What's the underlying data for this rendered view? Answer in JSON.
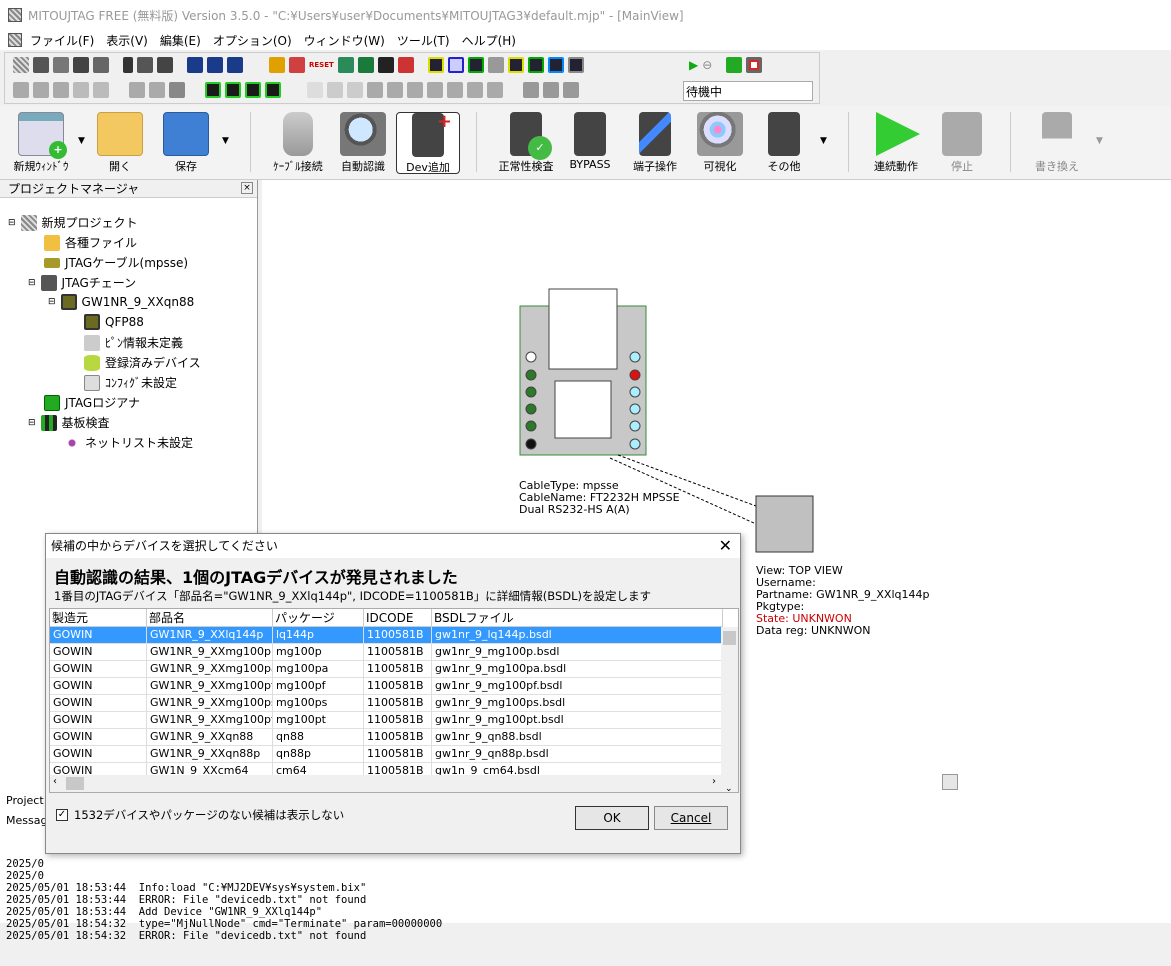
{
  "window": {
    "title": "MITOUJTAG FREE (無料版) Version 3.5.0 - \"C:¥Users¥user¥Documents¥MITOUJTAG3¥default.mjp\" - [MainView]"
  },
  "menu": [
    "ファイル(F)",
    "表示(V)",
    "編集(E)",
    "オプション(O)",
    "ウィンドウ(W)",
    "ツール(T)",
    "ヘルプ(H)"
  ],
  "toolbar": {
    "status_value": "待機中",
    "reset_label": "RESET"
  },
  "ribbon": [
    {
      "label": "新規ｳｨﾝﾄﾞｳ",
      "icon": "new-window-icon"
    },
    {
      "label": "開く",
      "icon": "open-folder-icon"
    },
    {
      "label": "保存",
      "icon": "save-icon"
    },
    {
      "label": "ｹｰﾌﾞﾙ接続",
      "icon": "cable-icon"
    },
    {
      "label": "自動認識",
      "icon": "auto-detect-icon"
    },
    {
      "label": "Dev追加",
      "icon": "add-device-icon"
    },
    {
      "label": "正常性検査",
      "icon": "check-icon"
    },
    {
      "label": "BYPASS",
      "icon": "bypass-icon"
    },
    {
      "label": "端子操作",
      "icon": "pin-operation-icon"
    },
    {
      "label": "可視化",
      "icon": "visualize-icon"
    },
    {
      "label": "その他",
      "icon": "other-icon"
    },
    {
      "label": "連続動作",
      "icon": "play-icon"
    },
    {
      "label": "停止",
      "icon": "stop-icon"
    },
    {
      "label": "書き換え",
      "icon": "write-icon"
    }
  ],
  "project": {
    "header": "プロジェクトマネージャ",
    "tree": [
      {
        "label": "新規プロジェクト",
        "level": 0
      },
      {
        "label": "各種ファイル",
        "level": 1
      },
      {
        "label": "JTAGケーブル(mpsse)",
        "level": 1
      },
      {
        "label": "JTAGチェーン",
        "level": 1
      },
      {
        "label": "GW1NR_9_XXqn88",
        "level": 2
      },
      {
        "label": "QFP88",
        "level": 3
      },
      {
        "label": "ﾋﾟﾝ情報未定義",
        "level": 3
      },
      {
        "label": "登録済みデバイス",
        "level": 3
      },
      {
        "label": "ｺﾝﾌｨｸﾞ未設定",
        "level": 3
      },
      {
        "label": "JTAGロジアナ",
        "level": 1
      },
      {
        "label": "基板検査",
        "level": 1
      },
      {
        "label": "ネットリスト未設定",
        "level": 2
      }
    ],
    "tab": "Project"
  },
  "cable": {
    "lines": [
      "CableType: mpsse",
      "CableName: FT2232H MPSSE",
      "Dual RS232-HS A(A)"
    ]
  },
  "device": {
    "lines": [
      "View: TOP VIEW",
      "Username:",
      "Partname: GW1NR_9_XXlq144p",
      "Pkgtype:",
      "State: UNKNWON",
      "Data reg: UNKNWON"
    ],
    "state_color": "#cc0000"
  },
  "dialog": {
    "title": "候補の中からデバイスを選択してください",
    "heading": "自動認識の結果、1個のJTAGデバイスが発見されました",
    "subtext": "1番目のJTAGデバイス「部品名=\"GW1NR_9_XXlq144p\", IDCODE=1100581B」に詳細情報(BSDL)を設定します",
    "columns": [
      "製造元",
      "部品名",
      "パッケージ",
      "IDCODE",
      "BSDLファイル"
    ],
    "rows": [
      [
        "GOWIN",
        "GW1NR_9_XXlq144p",
        "lq144p",
        "1100581B",
        "gw1nr_9_lq144p.bsdl"
      ],
      [
        "GOWIN",
        "GW1NR_9_XXmg100p",
        "mg100p",
        "1100581B",
        "gw1nr_9_mg100p.bsdl"
      ],
      [
        "GOWIN",
        "GW1NR_9_XXmg100pa",
        "mg100pa",
        "1100581B",
        "gw1nr_9_mg100pa.bsdl"
      ],
      [
        "GOWIN",
        "GW1NR_9_XXmg100pf",
        "mg100pf",
        "1100581B",
        "gw1nr_9_mg100pf.bsdl"
      ],
      [
        "GOWIN",
        "GW1NR_9_XXmg100ps",
        "mg100ps",
        "1100581B",
        "gw1nr_9_mg100ps.bsdl"
      ],
      [
        "GOWIN",
        "GW1NR_9_XXmg100pt",
        "mg100pt",
        "1100581B",
        "gw1nr_9_mg100pt.bsdl"
      ],
      [
        "GOWIN",
        "GW1NR_9_XXqn88",
        "qn88",
        "1100581B",
        "gw1nr_9_qn88.bsdl"
      ],
      [
        "GOWIN",
        "GW1NR_9_XXqn88p",
        "qn88p",
        "1100581B",
        "gw1nr_9_qn88p.bsdl"
      ],
      [
        "GOWIN",
        "GW1N_9_XXcm64",
        "cm64",
        "1100581B",
        "gw1n_9_cm64.bsdl"
      ]
    ],
    "checkbox_label": "1532デバイスやパッケージのない候補は表示しない",
    "ok": "OK",
    "cancel": "Cancel"
  },
  "messages": {
    "tab": "Messag",
    "lines": [
      "2025/0",
      "2025/0",
      "2025/05/01 18:53:44  Info:load \"C:¥MJ2DEV¥sys¥system.bix\"",
      "2025/05/01 18:53:44  ERROR: File \"devicedb.txt\" not found",
      "2025/05/01 18:53:44  Add Device \"GW1NR_9_XXlq144p\"",
      "2025/05/01 18:54:32  type=\"MjNullNode\" cmd=\"Terminate\" param=00000000",
      "2025/05/01 18:54:32  ERROR: File \"devicedb.txt\" not found"
    ]
  }
}
